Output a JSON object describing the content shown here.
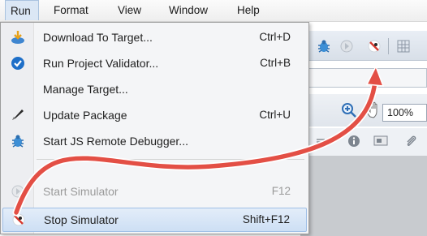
{
  "menubar": {
    "items": [
      "Run",
      "Format",
      "View",
      "Window",
      "Help"
    ]
  },
  "menu": {
    "items": [
      {
        "label": "Download To Target...",
        "shortcut": "Ctrl+D"
      },
      {
        "label": "Run Project Validator...",
        "shortcut": "Ctrl+B"
      },
      {
        "label": "Manage Target...",
        "shortcut": ""
      },
      {
        "label": "Update Package",
        "shortcut": "Ctrl+U"
      },
      {
        "label": "Start JS Remote Debugger...",
        "shortcut": ""
      },
      {
        "label": "Start Simulator",
        "shortcut": "F12",
        "disabled": true
      },
      {
        "label": "Stop Simulator",
        "shortcut": "Shift+F12",
        "highlighted": true
      }
    ]
  },
  "toolbar": {
    "zoom_value": "100%"
  },
  "colors": {
    "arrow": "#e34f45",
    "highlight": "#cddff4",
    "accent_blue": "#1e6fc8"
  }
}
